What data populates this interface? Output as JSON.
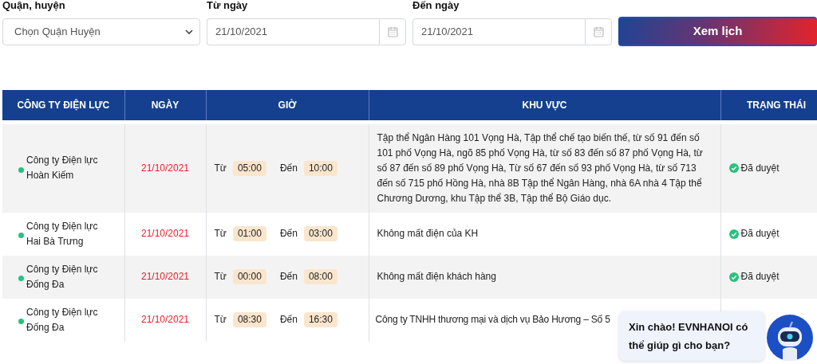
{
  "filters": {
    "district": {
      "label": "Quận, huyện",
      "placeholder": "Chọn Quận Huyện"
    },
    "from_date": {
      "label": "Từ ngày",
      "value": "21/10/2021"
    },
    "to_date": {
      "label": "Đến ngày",
      "value": "21/10/2021"
    },
    "submit": "Xem lịch"
  },
  "table": {
    "columns": [
      "CÔNG TY ĐIỆN LỰC",
      "NGÀY",
      "GIỜ",
      "KHU VỰC",
      "TRẠNG THÁI"
    ],
    "rows": [
      {
        "company": "Công ty Điện lực Hoàn Kiếm",
        "date": "21/10/2021",
        "from_label": "Từ",
        "from": "05:00",
        "to_label": "Đến",
        "to": "10:00",
        "area": "Tập thể Ngân Hàng 101 Vọng Hà, Tập thể chế tạo biến thế, từ số 91 đến số 101 phố Vọng Hà, ngõ 85 phố Vọng Hà, từ số 83 đến số 87 phố Vọng Hà, từ số 87 đến số 89 phố Vọng Hà, Từ số 67 đến số 93 phố Vọng Hà, từ số 713 đến số 715 phố Hồng Hà, nhà 8B Tập thể Ngân Hàng, nhà 6A nhà 4 Tập thể Chương Dương, khu Tập thể 3B, Tập thể Bộ Giáo dục.",
        "status": "Đã duyệt"
      },
      {
        "company": "Công ty Điện lực Hai Bà Trưng",
        "date": "21/10/2021",
        "from_label": "Từ",
        "from": "01:00",
        "to_label": "Đến",
        "to": "03:00",
        "area": "Không mất điện của KH",
        "status": "Đã duyệt"
      },
      {
        "company": "Công ty Điện lực Đống Đa",
        "date": "21/10/2021",
        "from_label": "Từ",
        "from": "00:00",
        "to_label": "Đến",
        "to": "08:00",
        "area": "Không mất điện khách hàng",
        "status": "Đã duyệt"
      },
      {
        "company": "Công ty Điện lực Đống Đa",
        "date": "21/10/2021",
        "from_label": "Từ",
        "from": "08:30",
        "to_label": "Đến",
        "to": "16:30",
        "area": "Công ty TNHH thương mại và dịch vụ Bảo Hương – Số 5"
      }
    ]
  },
  "chat": {
    "greeting": "Xin chào! EVNHANOI có thể giúp gì cho bạn?"
  }
}
